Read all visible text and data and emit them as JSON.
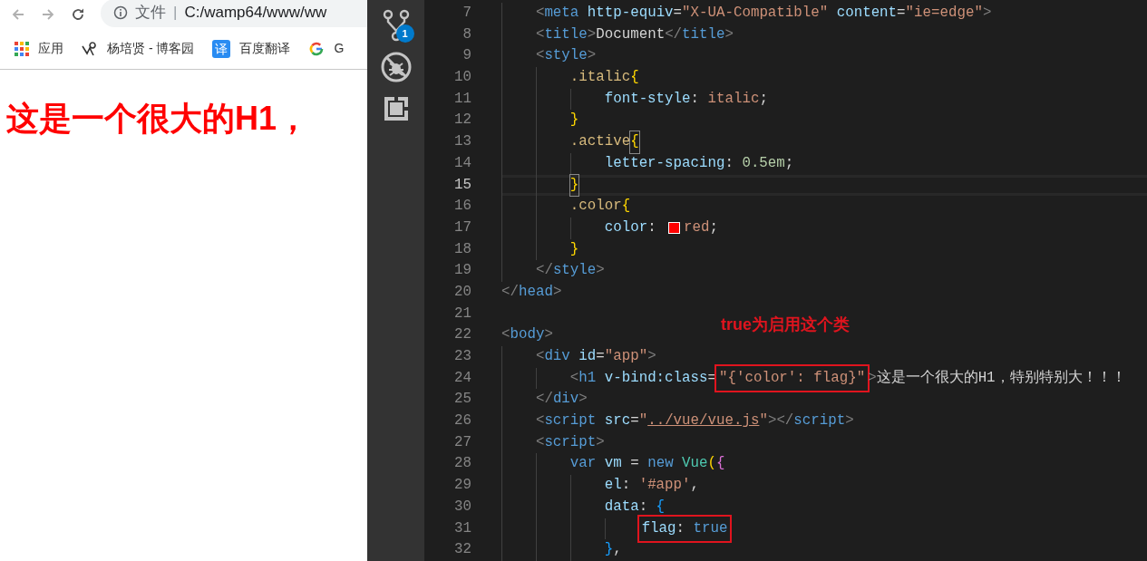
{
  "browser": {
    "address_bar": {
      "scheme_label": "文件",
      "separator": "|",
      "url": "C:/wamp64/www/ww"
    },
    "bookmarks": [
      {
        "kind": "apps",
        "label": "应用"
      },
      {
        "kind": "blog",
        "label": "杨培贤 - 博客园"
      },
      {
        "kind": "translate",
        "icon_text": "译",
        "label": "百度翻译"
      },
      {
        "kind": "google",
        "label": "G"
      }
    ],
    "page_heading": "这是一个很大的H1，"
  },
  "editor": {
    "activity_bar": [
      {
        "kind": "source-control",
        "badge": "1"
      },
      {
        "kind": "no-debug"
      },
      {
        "kind": "extensions"
      }
    ],
    "annotation": "true为启用这个类",
    "lines": [
      {
        "number": "7",
        "current": false,
        "tokens": [
          {
            "kind": "tagp",
            "text": "    <"
          },
          {
            "kind": "tag",
            "text": "meta"
          },
          {
            "kind": "attr",
            "text": " http-equiv"
          },
          {
            "kind": "punct",
            "text": "="
          },
          {
            "kind": "str",
            "text": "\"X-UA-Compatible\""
          },
          {
            "kind": "attr",
            "text": " content"
          },
          {
            "kind": "punct",
            "text": "="
          },
          {
            "kind": "str",
            "text": "\"ie=edge\""
          },
          {
            "kind": "tagp",
            "text": ">"
          }
        ]
      },
      {
        "number": "8",
        "current": false,
        "tokens": [
          {
            "kind": "tagp",
            "text": "    <"
          },
          {
            "kind": "tag",
            "text": "title"
          },
          {
            "kind": "tagp",
            "text": ">"
          },
          {
            "kind": "text",
            "text": "Document"
          },
          {
            "kind": "tagp",
            "text": "</"
          },
          {
            "kind": "tag",
            "text": "title"
          },
          {
            "kind": "tagp",
            "text": ">"
          }
        ]
      },
      {
        "number": "9",
        "current": false,
        "tokens": [
          {
            "kind": "tagp",
            "text": "    <"
          },
          {
            "kind": "tag",
            "text": "style"
          },
          {
            "kind": "tagp",
            "text": ">"
          }
        ]
      },
      {
        "number": "10",
        "current": false,
        "tokens": [
          {
            "kind": "sel",
            "text": "        .italic"
          },
          {
            "kind": "b1",
            "text": "{"
          }
        ]
      },
      {
        "number": "11",
        "current": false,
        "tokens": [
          {
            "kind": "prop",
            "text": "            font-style"
          },
          {
            "kind": "punct",
            "text": ": "
          },
          {
            "kind": "str",
            "text": "italic"
          },
          {
            "kind": "punct",
            "text": ";"
          }
        ]
      },
      {
        "number": "12",
        "current": false,
        "tokens": [
          {
            "kind": "b1",
            "text": "        }"
          }
        ]
      },
      {
        "number": "13",
        "current": false,
        "tokens": [
          {
            "kind": "sel",
            "text": "        .active"
          },
          {
            "kind": "b1",
            "text": "{",
            "matched": true
          }
        ]
      },
      {
        "number": "14",
        "current": false,
        "tokens": [
          {
            "kind": "prop",
            "text": "            letter-spacing"
          },
          {
            "kind": "punct",
            "text": ": "
          },
          {
            "kind": "num",
            "text": "0.5em"
          },
          {
            "kind": "punct",
            "text": ";"
          }
        ]
      },
      {
        "number": "15",
        "current": true,
        "tokens": [
          {
            "kind": "b1",
            "text": "        }",
            "matched": true
          }
        ]
      },
      {
        "number": "16",
        "current": false,
        "tokens": [
          {
            "kind": "sel",
            "text": "        .color"
          },
          {
            "kind": "b1",
            "text": "{"
          }
        ]
      },
      {
        "number": "17",
        "current": false,
        "tokens": [
          {
            "kind": "prop",
            "text": "            color"
          },
          {
            "kind": "punct",
            "text": ": "
          },
          {
            "kind": "swatch",
            "color": "#ff0000"
          },
          {
            "kind": "str",
            "text": "red"
          },
          {
            "kind": "punct",
            "text": ";"
          }
        ]
      },
      {
        "number": "18",
        "current": false,
        "tokens": [
          {
            "kind": "b1",
            "text": "        }"
          }
        ]
      },
      {
        "number": "19",
        "current": false,
        "tokens": [
          {
            "kind": "tagp",
            "text": "    </"
          },
          {
            "kind": "tag",
            "text": "style"
          },
          {
            "kind": "tagp",
            "text": ">"
          }
        ]
      },
      {
        "number": "20",
        "current": false,
        "tokens": [
          {
            "kind": "tagp",
            "text": "</"
          },
          {
            "kind": "tag",
            "text": "head"
          },
          {
            "kind": "tagp",
            "text": ">"
          }
        ]
      },
      {
        "number": "21",
        "current": false
      },
      {
        "number": "22",
        "current": false,
        "tokens": [
          {
            "kind": "tagp",
            "text": "<"
          },
          {
            "kind": "tag",
            "text": "body"
          },
          {
            "kind": "tagp",
            "text": ">"
          }
        ]
      },
      {
        "number": "23",
        "current": false,
        "tokens": [
          {
            "kind": "tagp",
            "text": "    <"
          },
          {
            "kind": "tag",
            "text": "div"
          },
          {
            "kind": "attr",
            "text": " id"
          },
          {
            "kind": "punct",
            "text": "="
          },
          {
            "kind": "str",
            "text": "\"app\""
          },
          {
            "kind": "tagp",
            "text": ">"
          }
        ]
      },
      {
        "number": "24",
        "current": false,
        "tokens": [
          {
            "kind": "tagp",
            "text": "        <"
          },
          {
            "kind": "tag",
            "text": "h1"
          },
          {
            "kind": "attr",
            "text": " v-bind:class"
          },
          {
            "kind": "punct",
            "text": "="
          },
          {
            "kind": "str",
            "text": "\"{'color': flag}\"",
            "boxed": true
          },
          {
            "kind": "tagp",
            "text": ">"
          },
          {
            "kind": "text",
            "text": "这是一个很大的H1，特别特别大！！！"
          }
        ]
      },
      {
        "number": "25",
        "current": false,
        "tokens": [
          {
            "kind": "tagp",
            "text": "    </"
          },
          {
            "kind": "tag",
            "text": "div"
          },
          {
            "kind": "tagp",
            "text": ">"
          }
        ]
      },
      {
        "number": "26",
        "current": false,
        "tokens": [
          {
            "kind": "tagp",
            "text": "    <"
          },
          {
            "kind": "tag",
            "text": "script"
          },
          {
            "kind": "attr",
            "text": " src"
          },
          {
            "kind": "punct",
            "text": "="
          },
          {
            "kind": "str",
            "text": "\""
          },
          {
            "kind": "link",
            "text": "../vue/vue.js"
          },
          {
            "kind": "str",
            "text": "\""
          },
          {
            "kind": "tagp",
            "text": "></"
          },
          {
            "kind": "tag",
            "text": "script"
          },
          {
            "kind": "tagp",
            "text": ">"
          }
        ]
      },
      {
        "number": "27",
        "current": false,
        "tokens": [
          {
            "kind": "tagp",
            "text": "    <"
          },
          {
            "kind": "tag",
            "text": "script"
          },
          {
            "kind": "tagp",
            "text": ">"
          }
        ]
      },
      {
        "number": "28",
        "current": false,
        "tokens": [
          {
            "kind": "kw",
            "text": "        var"
          },
          {
            "kind": "var",
            "text": " vm"
          },
          {
            "kind": "punct",
            "text": " = "
          },
          {
            "kind": "kw",
            "text": "new"
          },
          {
            "kind": "cls",
            "text": " Vue"
          },
          {
            "kind": "b1",
            "text": "("
          },
          {
            "kind": "b2",
            "text": "{"
          }
        ]
      },
      {
        "number": "29",
        "current": false,
        "tokens": [
          {
            "kind": "prop",
            "text": "            el"
          },
          {
            "kind": "punct",
            "text": ": "
          },
          {
            "kind": "str",
            "text": "'#app'"
          },
          {
            "kind": "punct",
            "text": ","
          }
        ]
      },
      {
        "number": "30",
        "current": false,
        "tokens": [
          {
            "kind": "prop",
            "text": "            data"
          },
          {
            "kind": "punct",
            "text": ": "
          },
          {
            "kind": "b3",
            "text": "{"
          }
        ]
      },
      {
        "number": "31",
        "current": false,
        "tokens": [
          {
            "kind": "prop",
            "text": "                flag",
            "boxed": true
          },
          {
            "kind": "punct",
            "text": ": ",
            "boxed": true
          },
          {
            "kind": "kw",
            "text": "true",
            "boxed": true
          }
        ]
      },
      {
        "number": "32",
        "current": false,
        "tokens": [
          {
            "kind": "b3",
            "text": "            }"
          },
          {
            "kind": "punct",
            "text": ","
          }
        ]
      }
    ]
  }
}
